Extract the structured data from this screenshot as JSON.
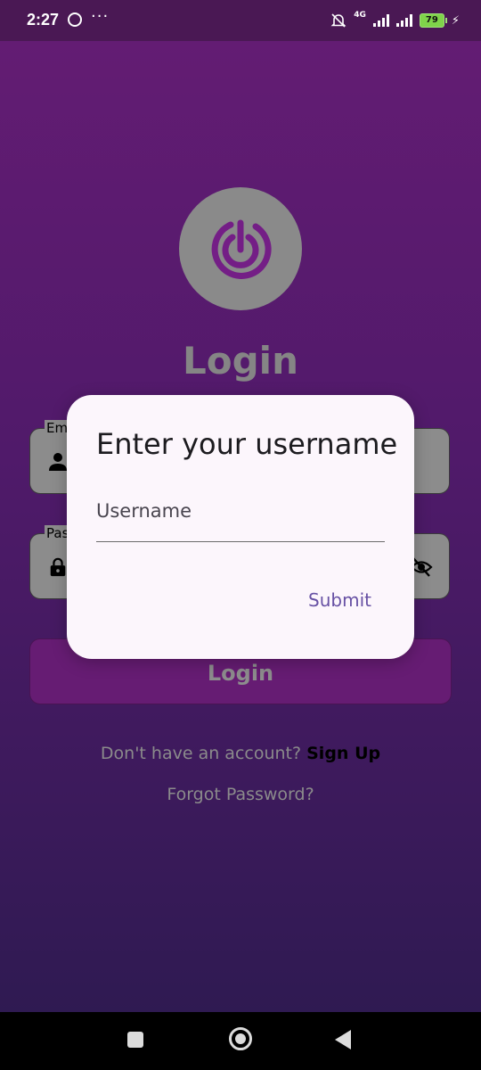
{
  "status_bar": {
    "time": "2:27",
    "dots": "···",
    "network": "4G",
    "battery": "79",
    "bolt": "⚡"
  },
  "icons": {
    "app_logo": "power-target-icon",
    "email": "person-icon",
    "password": "lock-icon",
    "visibility": "eye-off-icon"
  },
  "login": {
    "title": "Login",
    "email_label": "Em",
    "password_label": "Pas",
    "button_label": "Login",
    "signup_prompt": "Don't have an account?",
    "signup_link": "Sign Up",
    "forgot": "Forgot Password?"
  },
  "dialog": {
    "title": "Enter your username",
    "input_placeholder": "Username",
    "submit_label": "Submit"
  },
  "colors": {
    "accent": "#6751a4",
    "logo_purple": "#741e86",
    "background_top": "#651c74",
    "background_bottom": "#2f1a52"
  }
}
